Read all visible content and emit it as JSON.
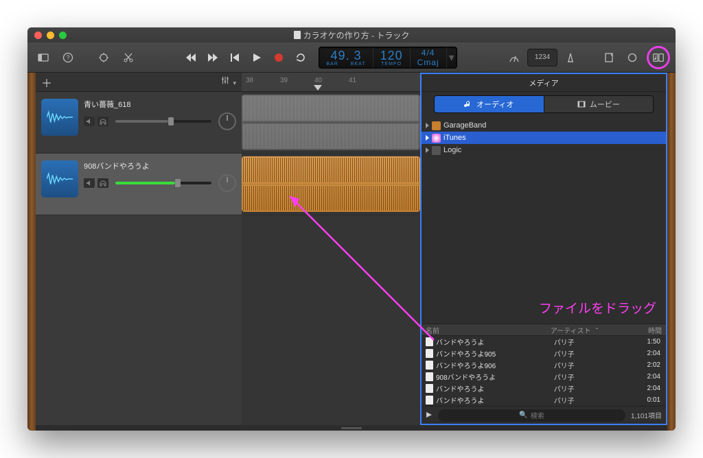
{
  "window": {
    "title": "カラオケの作り方 - トラック"
  },
  "lcd": {
    "bar": "49",
    "beat": "3",
    "bar_lab": "BAR",
    "beat_lab": "BEAT",
    "tempo": "120",
    "tempo_lab": "TEMPO",
    "sig": "4/4",
    "key": "Cmaj"
  },
  "toolbar": {
    "notes": "1234"
  },
  "ruler": {
    "m38": "38",
    "m39": "39",
    "m40": "40",
    "m41": "41"
  },
  "tracks": [
    {
      "name": "青い薔薇_618",
      "vol_pct": 55,
      "fill_color": "#666"
    },
    {
      "name": "908バンドやろうよ",
      "vol_pct": 62,
      "fill_color": "#3bdc3b"
    }
  ],
  "media": {
    "title": "メディア",
    "tab_audio": "オーディオ",
    "tab_movie": "ムービー",
    "sources": {
      "gb": "GarageBand",
      "it": "iTunes",
      "lg": "Logic"
    },
    "annotation": "ファイルをドラッグ",
    "cols": {
      "name": "名前",
      "artist": "アーティスト",
      "time": "時間"
    },
    "rows": [
      {
        "name": "バンドやろうよ",
        "artist": "パリ子",
        "time": "1:50"
      },
      {
        "name": "バンドやろうよ905",
        "artist": "パリ子",
        "time": "2:04"
      },
      {
        "name": "バンドやろうよ906",
        "artist": "パリ子",
        "time": "2:02"
      },
      {
        "name": "908バンドやろうよ",
        "artist": "パリ子",
        "time": "2:04"
      },
      {
        "name": "バンドやろうよ",
        "artist": "パリ子",
        "time": "2:04"
      },
      {
        "name": "バンドやろうよ",
        "artist": "パリ子",
        "time": "0:01"
      }
    ],
    "search_placeholder": "検索",
    "count": "1,101項目"
  }
}
